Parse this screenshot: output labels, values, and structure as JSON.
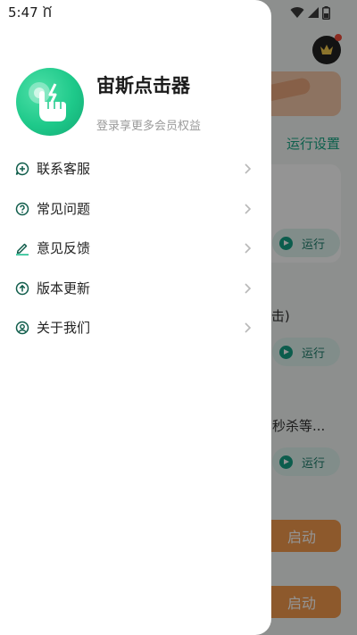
{
  "status_bar": {
    "time": "5:47",
    "notification_icon": "android-debug-icon",
    "right_icons": [
      "wifi-icon",
      "signal-icon",
      "battery-icon"
    ]
  },
  "drawer": {
    "app_name": "宙斯点击器",
    "login_hint": "登录享更多会员权益",
    "avatar_icon": "tap-hand-icon",
    "menu": [
      {
        "label": "联系客服",
        "icon": "chat-plus-icon"
      },
      {
        "label": "常见问题",
        "icon": "question-icon"
      },
      {
        "label": "意见反馈",
        "icon": "edit-icon"
      },
      {
        "label": "版本更新",
        "icon": "upgrade-icon"
      },
      {
        "label": "关于我们",
        "icon": "user-circle-icon"
      }
    ]
  },
  "background": {
    "settings_label": "运行设置",
    "run_labels": [
      "运行",
      "运行",
      "运行"
    ],
    "partial_texts": [
      "(击)",
      "秒杀等..."
    ],
    "start_labels": [
      "启动",
      "启动"
    ],
    "premium_icon": "vip-crown-icon"
  },
  "colors": {
    "accent": "#1fbf8f",
    "menu_icon": "#0f5c4a",
    "start_button": "#f39a4c",
    "premium_dot": "#f04b3a"
  }
}
